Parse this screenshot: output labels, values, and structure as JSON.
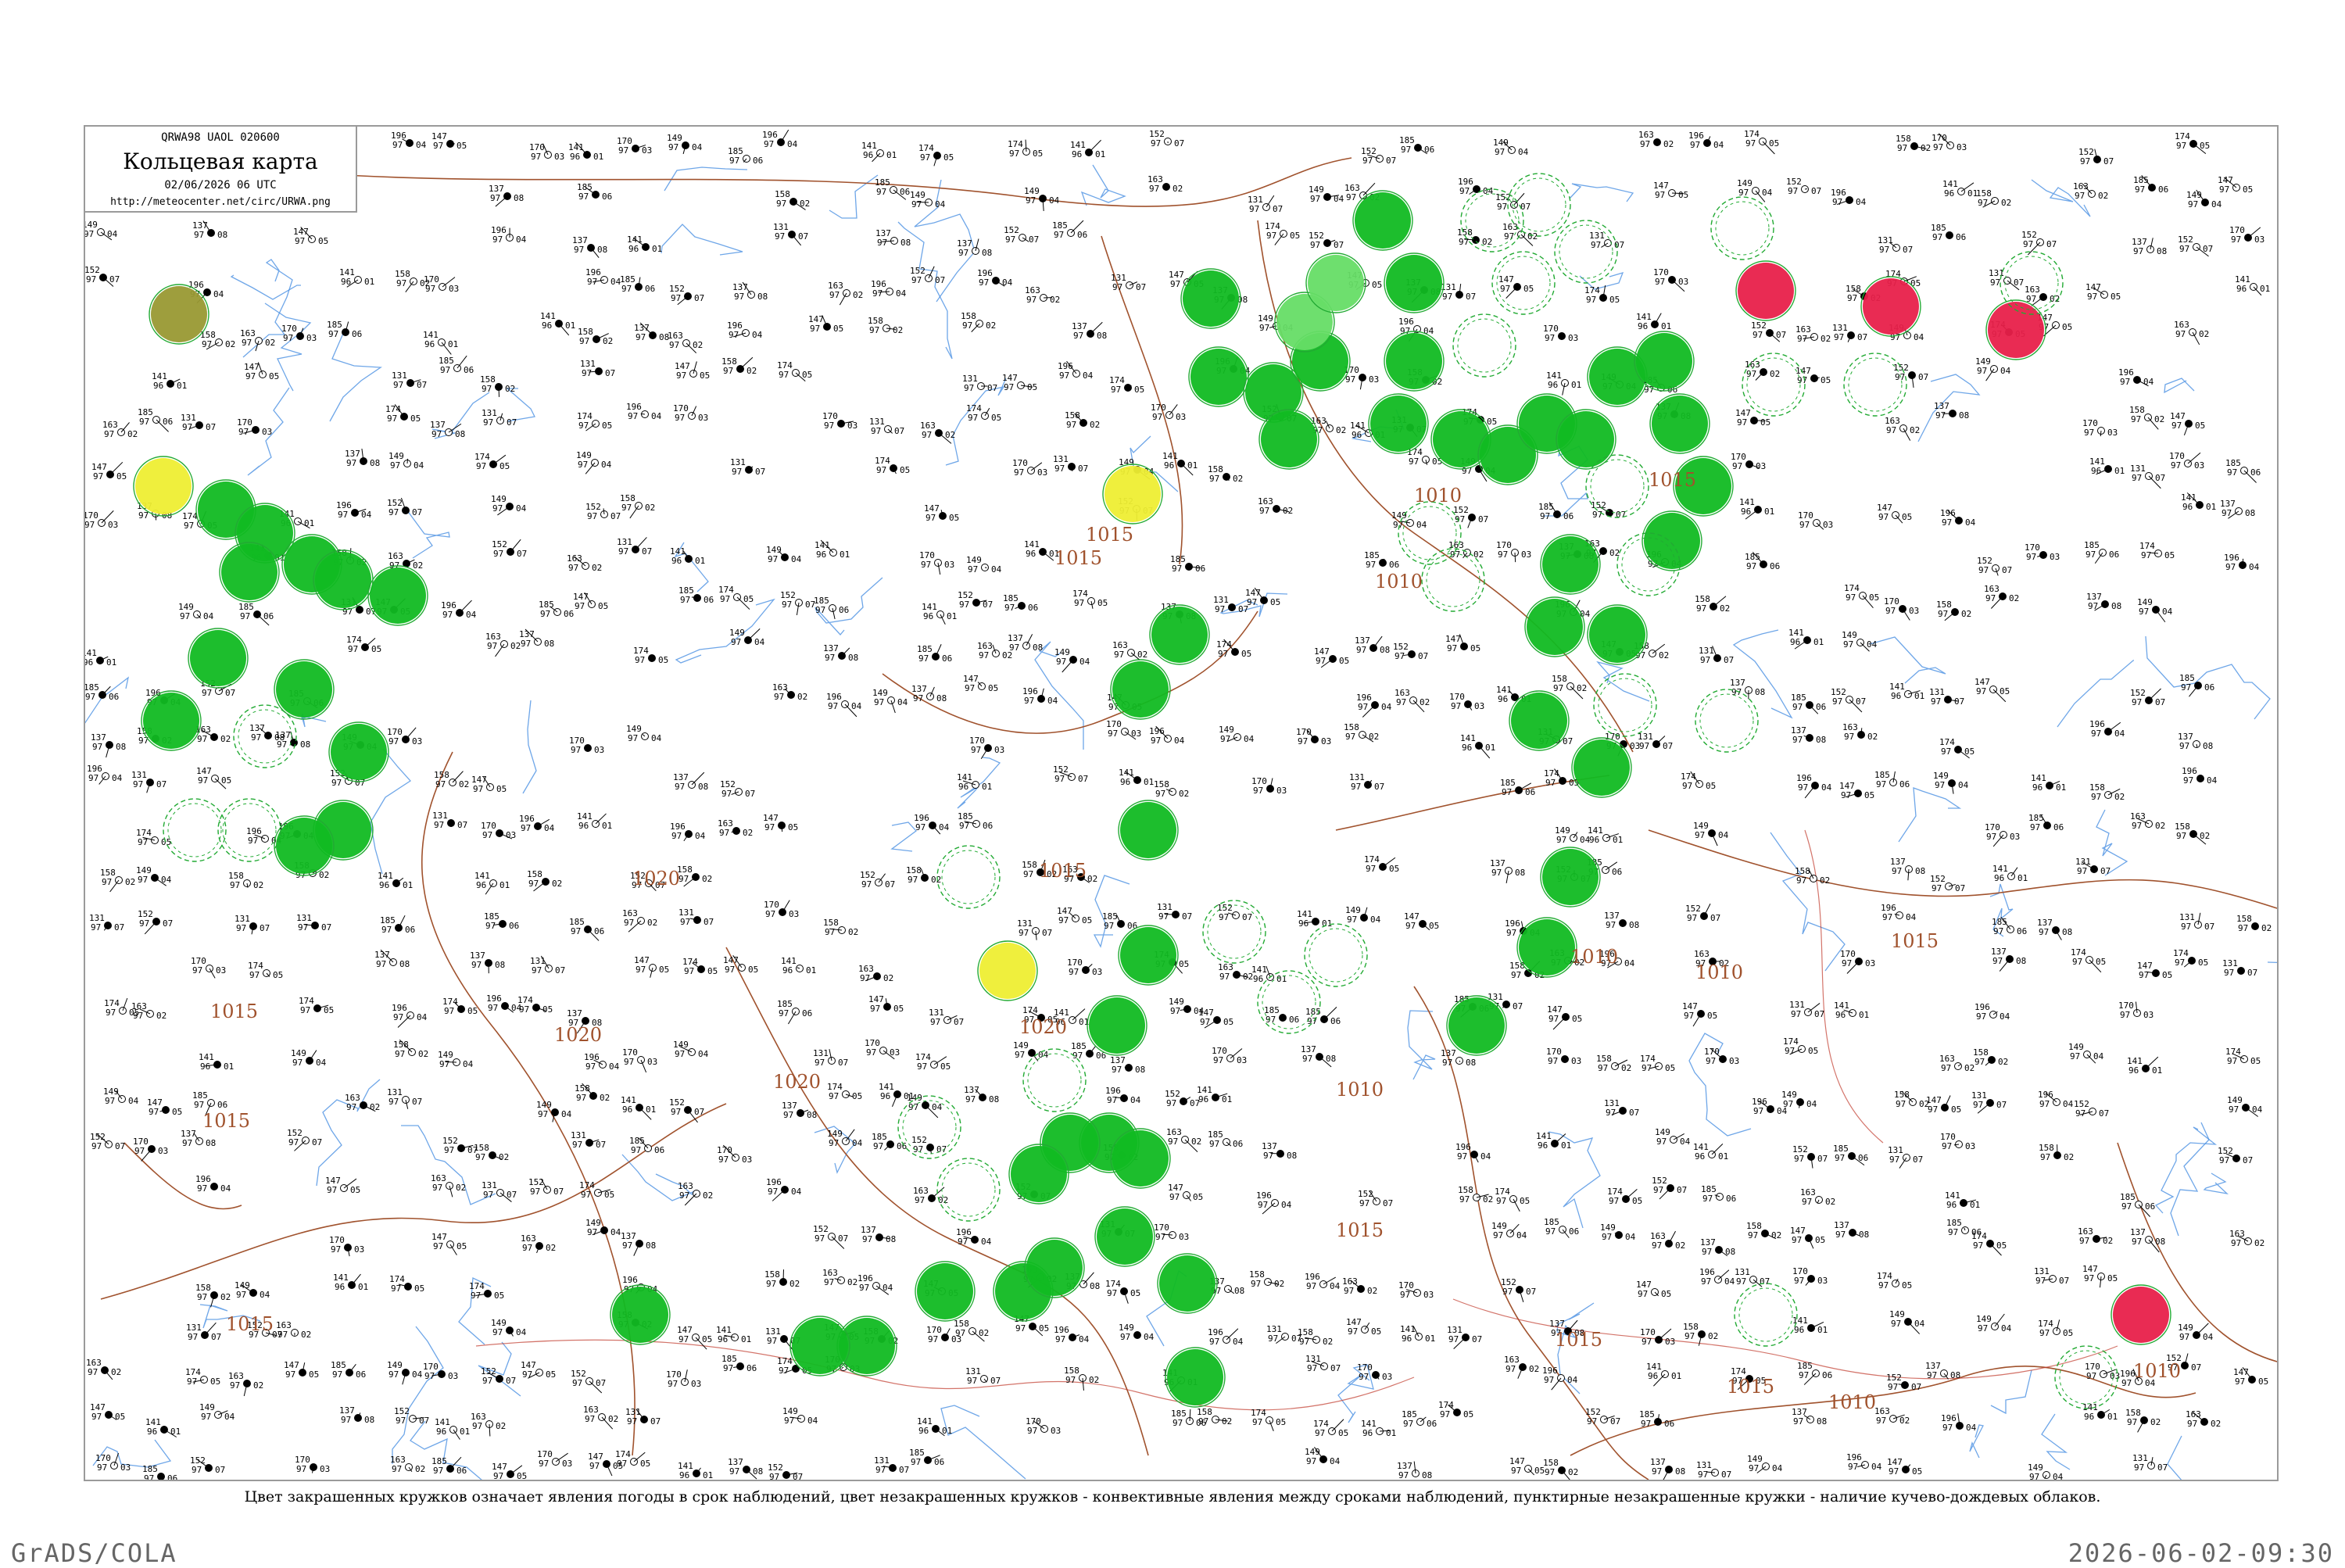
{
  "header": {
    "code": "QRWA98 UAOL 020600",
    "title": "Кольцевая карта",
    "datetime": "02/06/2026 06 UTC",
    "url": "http://meteocenter.net/circ/URWA.png"
  },
  "legend_note": "Цвет закрашенных кружков означает явления погоды в срок наблюдений, цвет незакрашенных кружков - конвективные явления между сроками наблюдений, пунктирные незакрашенные кружки - наличие кучево-дождевых облаков.",
  "footer": {
    "left": "GrADS/COLA",
    "right": "2026-06-02-09:30"
  },
  "colors": {
    "isobar": "#a0522d",
    "river": "#4a90e2",
    "border": "#c0392b",
    "rain_fill": "#11bb22",
    "shower_fill": "#66dd66",
    "fog_fill": "#eeee33",
    "dust_fill": "#999933",
    "thunder_fill": "#e8204a",
    "convective_ring": "#22aa33"
  },
  "isobar_labels": [
    "1015",
    "1015",
    "1015",
    "1015",
    "1010",
    "1015",
    "1020",
    "1020",
    "1020",
    "1020",
    "1015",
    "1015",
    "1015",
    "1010",
    "1010",
    "1015",
    "1010",
    "1015",
    "1010",
    "1010",
    "1015",
    "1010"
  ],
  "sample_stations": [
    {
      "t": "149",
      "p": "97",
      "b": "04"
    },
    {
      "t": "152",
      "p": "97",
      "b": "07"
    },
    {
      "t": "163",
      "p": "97",
      "b": "02"
    },
    {
      "t": "147",
      "p": "97",
      "b": "05"
    },
    {
      "t": "170",
      "p": "97",
      "b": "03"
    },
    {
      "t": "141",
      "p": "96",
      "b": "01"
    },
    {
      "t": "185",
      "p": "97",
      "b": "06"
    },
    {
      "t": "137",
      "p": "97",
      "b": "08"
    },
    {
      "t": "196",
      "p": "97",
      "b": "04"
    },
    {
      "t": "158",
      "p": "97",
      "b": "02"
    },
    {
      "t": "131",
      "p": "97",
      "b": "07"
    },
    {
      "t": "174",
      "p": "97",
      "b": "05"
    }
  ]
}
